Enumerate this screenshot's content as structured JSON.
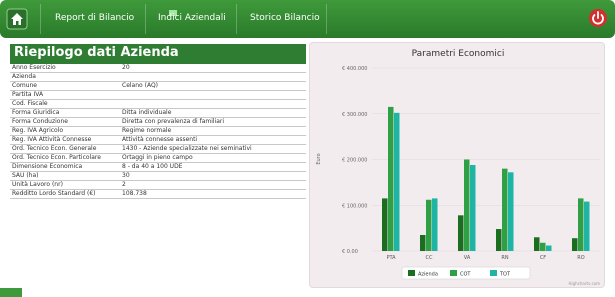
{
  "nav": {
    "items": [
      {
        "label": "Report di Bilancio"
      },
      {
        "label": "Indici Aziendali"
      },
      {
        "label": "Storico Bilancio"
      }
    ],
    "home_icon": "home-icon",
    "power_icon": "power-icon",
    "color": "#2f7d32"
  },
  "summary": {
    "title": "Riepilogo dati Azienda",
    "rows": [
      {
        "label": "Anno Esercizio",
        "value": "20"
      },
      {
        "label": "Azienda",
        "value": ""
      },
      {
        "label": "Comune",
        "value": "Celano (AQ)"
      },
      {
        "label": "Partita IVA",
        "value": ""
      },
      {
        "label": "Cod. Fiscale",
        "value": ""
      },
      {
        "label": "Forma Giuridica",
        "value": "Ditta individuale"
      },
      {
        "label": "Forma Conduzione",
        "value": "Diretta con prevalenza di familiari"
      },
      {
        "label": "Reg. IVA Agricolo",
        "value": "Regime normale"
      },
      {
        "label": "Reg. IVA Attività Connesse",
        "value": "Attività connesse assenti"
      },
      {
        "label": "Ord. Tecnico Econ. Generale",
        "value": "1430 - Aziende specializzate nei seminativi"
      },
      {
        "label": "Ord. Tecnico Econ. Particolare",
        "value": "Ortaggi in pieno campo"
      },
      {
        "label": "Dimensione Economica",
        "value": "8 - da 40 a 100 UDE"
      },
      {
        "label": "SAU (ha)",
        "value": "30"
      },
      {
        "label": "Unità Lavoro (nr)",
        "value": "2"
      },
      {
        "label": "Redditto Lordo Standard (€)",
        "value": "108.738"
      }
    ]
  },
  "chart_data": {
    "type": "bar",
    "title": "Parametri Economici",
    "ylabel": "Euro",
    "ylim": [
      0,
      400000
    ],
    "yticks": [
      "€ 0.00",
      "€ 100.000",
      "€ 200.000",
      "€ 300.000",
      "€ 400.000"
    ],
    "categories": [
      "PTA",
      "CC",
      "VA",
      "RN",
      "CF",
      "RO"
    ],
    "series": [
      {
        "name": "Azienda",
        "color": "#1b6e20",
        "values": [
          115000,
          35000,
          78000,
          48000,
          30000,
          28000
        ]
      },
      {
        "name": "COT",
        "color": "#2fa046",
        "values": [
          315000,
          112000,
          200000,
          180000,
          18000,
          115000
        ]
      },
      {
        "name": "TOT",
        "color": "#1fb5a5",
        "values": [
          302000,
          115000,
          188000,
          172000,
          12000,
          108000
        ]
      }
    ],
    "credit": "Highcharts.com"
  }
}
